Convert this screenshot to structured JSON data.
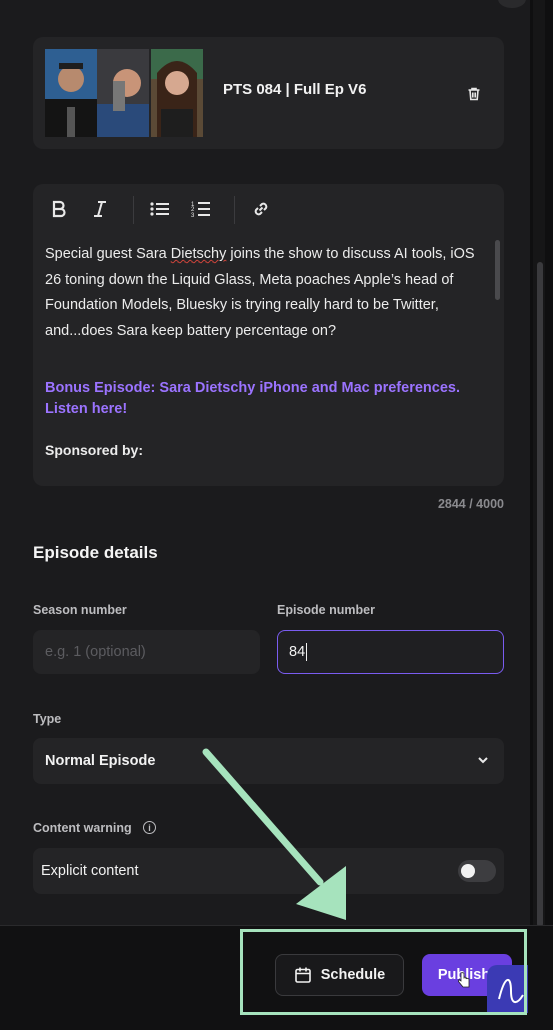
{
  "episode": {
    "title": "PTS 084 | Full Ep V6"
  },
  "editor": {
    "toolbar": [
      "bold",
      "italic",
      "bulleted-list",
      "numbered-list",
      "link"
    ],
    "paragraph_before": "Special guest Sara ",
    "paragraph_misspelled": "Dietschy",
    "paragraph_after": " joins the show to discuss AI tools, iOS 26 toning down the Liquid Glass, Meta poaches Apple’s head of Foundation Models, Bluesky is trying really hard to be Twitter, and...does Sara keep battery percentage on?",
    "bonus_link": "Bonus Episode: Sara Dietschy iPhone and Mac preferences. Listen here!",
    "sponsored": "Sponsored by:",
    "char_count": "2844 / 4000"
  },
  "details": {
    "heading": "Episode details",
    "season_label": "Season number",
    "season_placeholder": "e.g. 1 (optional)",
    "episode_label": "Episode number",
    "episode_value": "84",
    "type_label": "Type",
    "type_value": "Normal Episode",
    "warning_label": "Content warning",
    "explicit_label": "Explicit content",
    "explicit_on": false
  },
  "footer": {
    "schedule_label": "Schedule",
    "publish_label": "Publish"
  },
  "colors": {
    "accent": "#6a3fe0",
    "link": "#9b73ff",
    "annotation": "#a6e3bd"
  }
}
